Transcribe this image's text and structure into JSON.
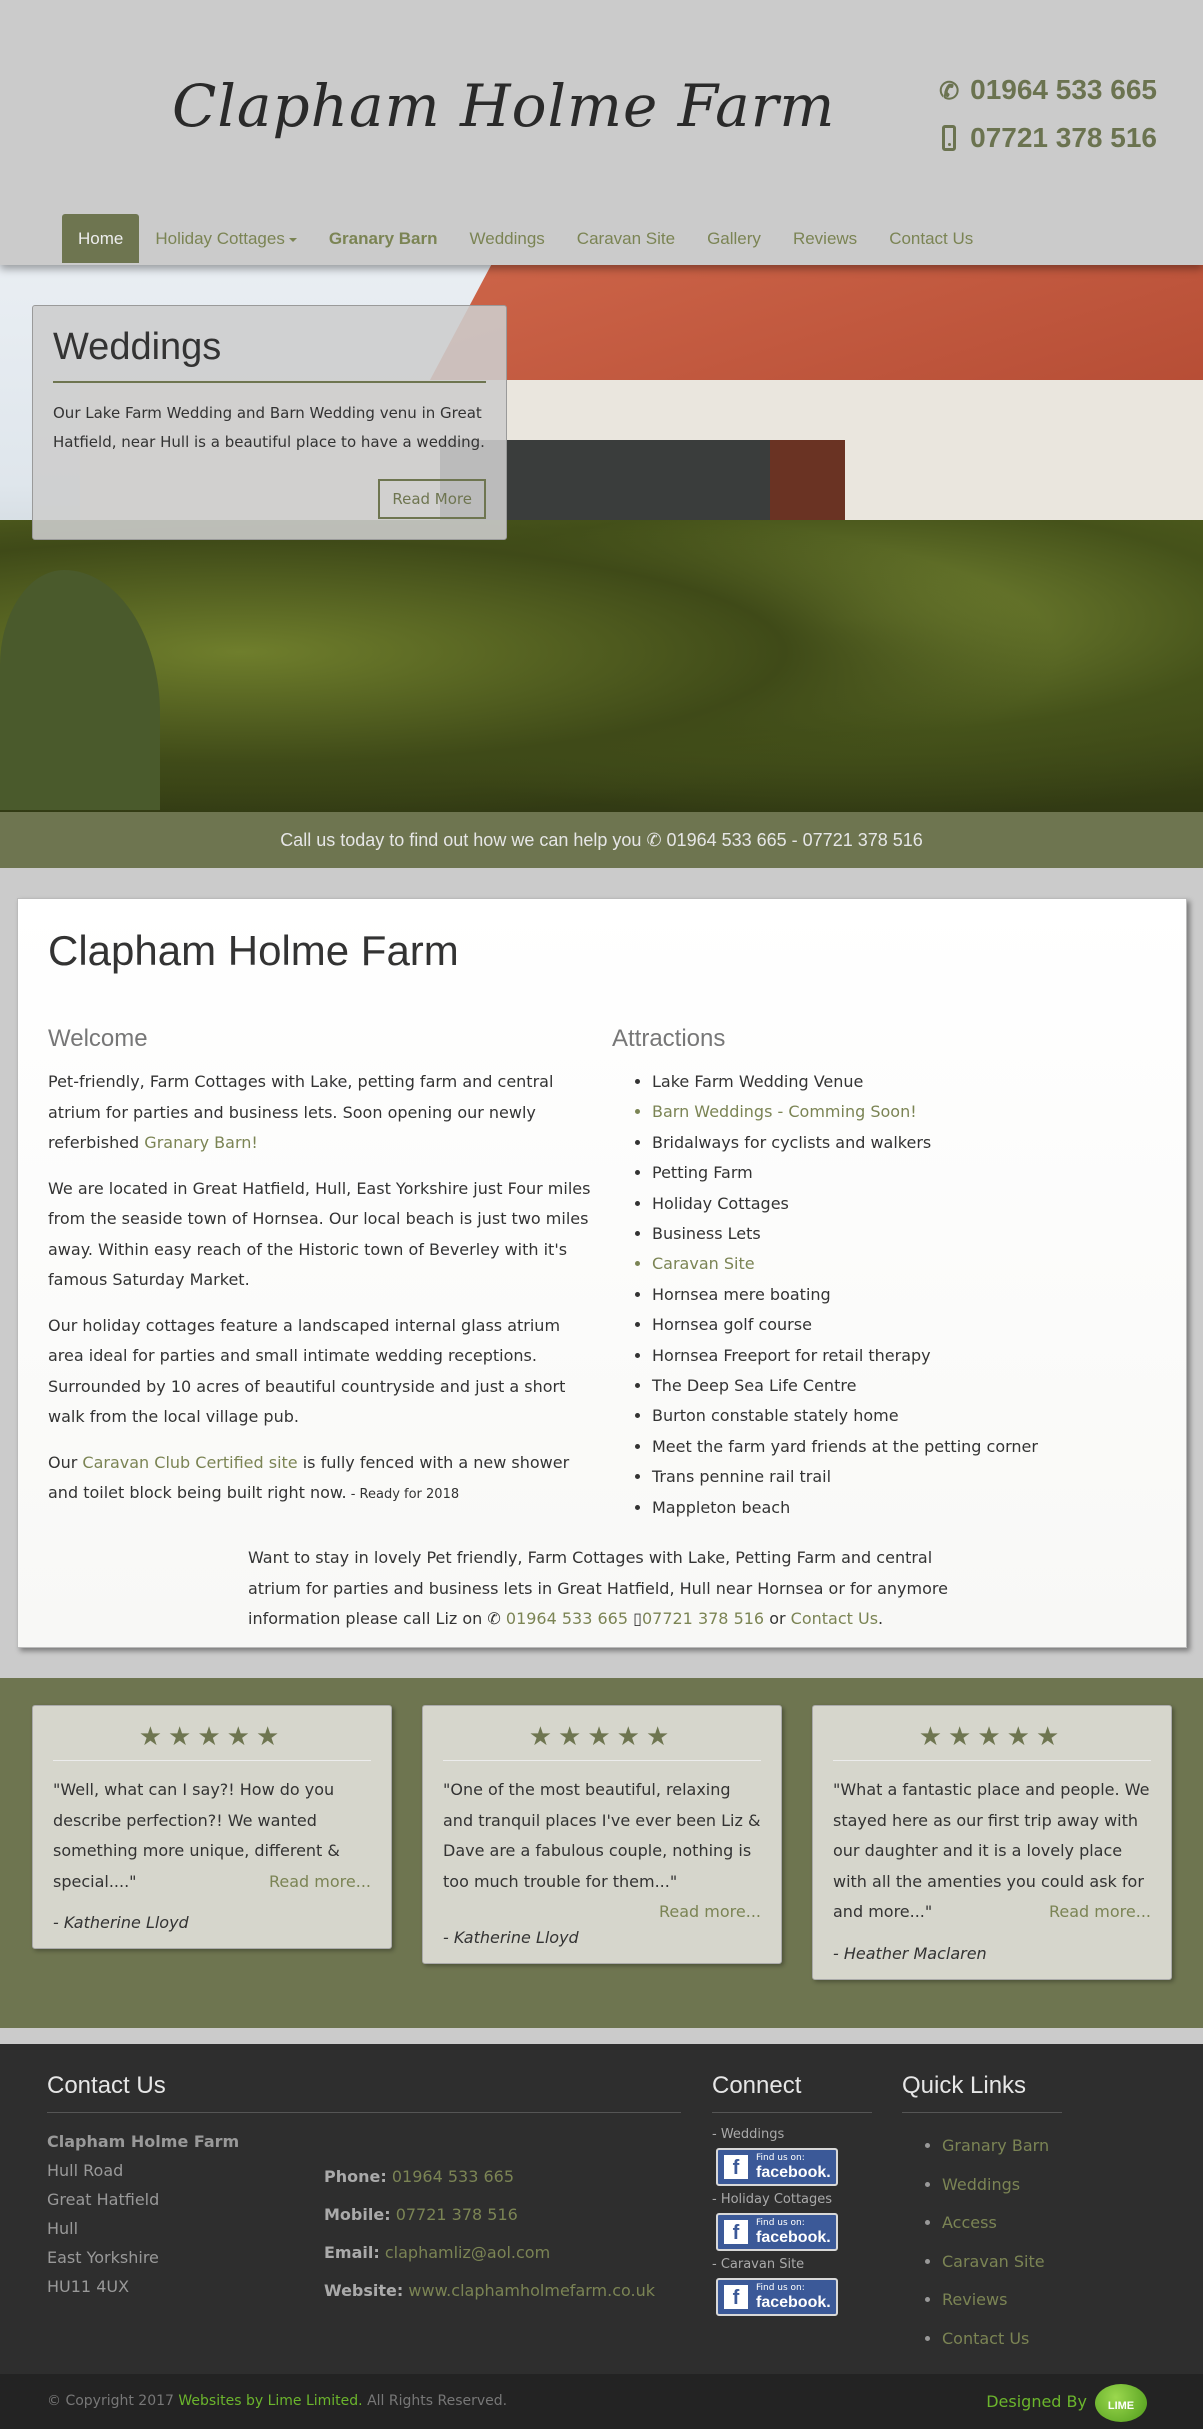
{
  "header": {
    "logo": "Clapham Holme Farm",
    "phone": "01964 533 665",
    "mobile": "07721 378 516"
  },
  "nav": {
    "items": [
      {
        "label": "Home"
      },
      {
        "label": "Holiday Cottages"
      },
      {
        "label": "Granary Barn"
      },
      {
        "label": "Weddings"
      },
      {
        "label": "Caravan Site"
      },
      {
        "label": "Gallery"
      },
      {
        "label": "Reviews"
      },
      {
        "label": "Contact Us"
      }
    ]
  },
  "promo": {
    "title": "Weddings",
    "text": "Our Lake Farm Wedding and Barn Wedding venu in Great Hatfield, near Hull is a beautiful place to have a wedding.",
    "button": "Read More"
  },
  "callbar": {
    "text": "Call us today to find out how we can help you",
    "numbers": "01964 533 665 - 07721 378 516"
  },
  "main": {
    "title": "Clapham Holme Farm",
    "welcome": {
      "heading": "Welcome",
      "p1_before": "Pet-friendly, Farm Cottages with Lake, petting farm and central atrium for parties and business lets. Soon opening our newly referbished ",
      "p1_link": "Granary Barn!",
      "p2": "We are located in Great Hatfield, Hull, East Yorkshire just Four miles from the seaside town of Hornsea. Our local beach is just two miles away. Within easy reach of the Historic town of Beverley with it's famous Saturday Market.",
      "p3": "Our holiday cottages feature a landscaped internal glass atrium area ideal for parties and small intimate wedding receptions. Surrounded by 10 acres of beautiful countryside and just a short walk from the local village pub.",
      "p4_before": "Our ",
      "p4_link": "Caravan Club Certified site",
      "p4_after": " is fully fenced with a new shower and toilet block being built right now.",
      "p4_small": " - Ready for 2018"
    },
    "attractions": {
      "heading": "Attractions",
      "items": [
        "Lake Farm Wedding Venue",
        "Barn Weddings - Comming Soon!",
        "Bridalways for cyclists and walkers",
        "Petting Farm",
        "Holiday Cottages",
        "Business Lets",
        "Caravan Site",
        "Hornsea mere boating",
        "Hornsea golf course",
        "Hornsea Freeport for retail therapy",
        "The Deep Sea Life Centre",
        "Burton constable stately home",
        "Meet the farm yard friends at the petting corner",
        "Trans pennine rail trail",
        "Mappleton beach"
      ]
    },
    "outro": {
      "before": "Want to stay in lovely Pet friendly, Farm Cottages with Lake, Petting Farm and central atrium for parties and business lets in Great Hatfield, Hull near Hornsea or for anymore information please call Liz on ",
      "phone": "01964 533 665",
      "mobile": "07721 378 516",
      "or": " or ",
      "contact": "Contact Us",
      "end": "."
    }
  },
  "reviews": [
    {
      "stars": "★★★★★",
      "text": "\"Well, what can I say?! How do you describe perfection?! We wanted something more unique, different & special....\"",
      "more": "Read more...",
      "author": "- Katherine Lloyd"
    },
    {
      "stars": "★★★★★",
      "text": "\"One of the most beautiful, relaxing and tranquil places I've ever been Liz & Dave are a fabulous couple, nothing is too much trouble for them...\"",
      "more": "Read more...",
      "author": "- Katherine Lloyd"
    },
    {
      "stars": "★★★★★",
      "text": "\"What a fantastic place and people. We stayed here as our first trip away with our daughter and it is a lovely place with all the amenties you could ask for and more...\"",
      "more": "Read more...",
      "author": "- Heather Maclaren"
    }
  ],
  "footer": {
    "contact": {
      "heading": "Contact Us",
      "name": "Clapham Holme Farm",
      "address": [
        "Hull Road",
        "Great Hatfield",
        "Hull",
        "East Yorkshire",
        "HU11 4UX"
      ],
      "phone_label": "Phone:",
      "phone": "01964 533 665",
      "mobile_label": "Mobile:",
      "mobile": "07721 378 516",
      "email_label": "Email:",
      "email": "claphamliz@aol.com",
      "website_label": "Website:",
      "website": "www.claphamholmefarm.co.uk"
    },
    "connect": {
      "heading": "Connect",
      "links": [
        "- Weddings",
        "- Holiday Cottages",
        "- Caravan Site"
      ],
      "fb_small": "Find us on:",
      "fb_big": "facebook."
    },
    "quick": {
      "heading": "Quick Links",
      "items": [
        "Granary Barn",
        "Weddings",
        "Access",
        "Caravan Site",
        "Reviews",
        "Contact Us"
      ]
    },
    "copyright_before": "© Copyright 2017 ",
    "copyright_link": "Websites by Lime Limited.",
    "copyright_after": " All Rights Reserved.",
    "designed_by": "Designed By",
    "lime_badge": "LIME"
  },
  "colors": {
    "accent": "#6e7550",
    "link": "#7b8454",
    "footer_bg": "#2e2e2e",
    "lime": "#6bb52c"
  }
}
